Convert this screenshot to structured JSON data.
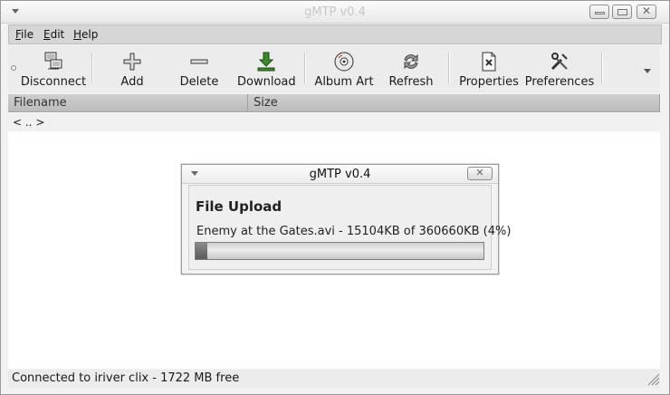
{
  "window": {
    "title": "gMTP v0.4"
  },
  "menubar": {
    "items": [
      "File",
      "Edit",
      "Help"
    ]
  },
  "toolbar": {
    "buttons": [
      {
        "label": "Disconnect",
        "icon": "disconnect-icon"
      },
      {
        "label": "Add",
        "icon": "plus-icon"
      },
      {
        "label": "Delete",
        "icon": "minus-icon"
      },
      {
        "label": "Download",
        "icon": "download-arrow-icon"
      },
      {
        "label": "Album Art",
        "icon": "cd-disc-icon"
      },
      {
        "label": "Refresh",
        "icon": "refresh-arrows-icon"
      },
      {
        "label": "Properties",
        "icon": "document-properties-icon"
      },
      {
        "label": "Preferences",
        "icon": "tools-icon"
      }
    ]
  },
  "filelist": {
    "columns": [
      "Filename",
      "Size"
    ],
    "rows": [
      {
        "filename": "< .. >",
        "size": ""
      }
    ]
  },
  "statusbar": {
    "text": "Connected to iriver clix - 1722 MB free"
  },
  "dialog": {
    "title": "gMTP v0.4",
    "heading": "File Upload",
    "message": "Enemy at the Gates.avi - 15104KB of 360660KB (4%)",
    "progress": 0.04
  },
  "colors": {
    "window_bg": "#f2f2f2",
    "header_bg": "#c4c4c4",
    "progress_fill": "#6a6a6a"
  }
}
